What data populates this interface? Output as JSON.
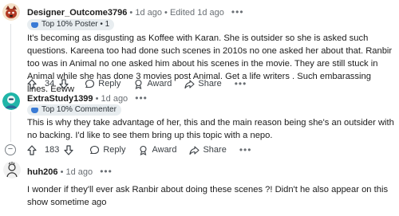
{
  "comments": [
    {
      "author": "Designer_Outcome3796",
      "time": "1d ago",
      "edited": "Edited 1d ago",
      "flair": "Top 10% Poster • 1",
      "body": "It's becoming as disgusting as Koffee with Karan. She is outsider so she is asked such questions. Kareena too had done such scenes in 2010s no one asked her about that. Ranbir too was in Animal no one asked him about his scenes in the movie. They are still stuck in Animal while she has done 3 movies post Animal. Get a life writers . Such embarassing lines. Eeww",
      "votes": "34",
      "reply": "Reply",
      "award": "Award",
      "share": "Share",
      "more": "•••"
    },
    {
      "author": "ExtraStudy1399",
      "time": "1d ago",
      "flair": "Top 10% Commenter",
      "body": "This is why they take advantage of her, this and the main reason being she's an outsider with no backing. I'd like to see them bring up this topic with a nepo.",
      "votes": "183",
      "reply": "Reply",
      "award": "Award",
      "share": "Share",
      "more": "•••",
      "collapse": "−"
    },
    {
      "author": "huh206",
      "time": "1d ago",
      "body": "I wonder if they'll ever ask Ranbir about doing these scenes ?! Didn't he also appear on this show sometime ago",
      "more": "•••"
    }
  ],
  "separator": "•",
  "colors": {
    "upvote_accent": "#1c1c1c",
    "flair_badge": "#3a7bd5"
  }
}
